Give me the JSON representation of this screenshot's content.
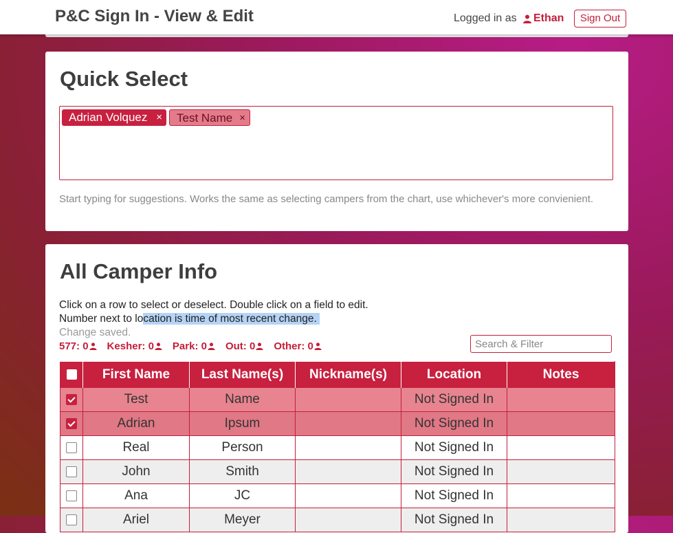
{
  "header": {
    "title": "P&C Sign In - View & Edit",
    "logged_in_label": "Logged in as",
    "user_name": "Ethan",
    "sign_out_label": "Sign Out"
  },
  "quick_select": {
    "title": "Quick Select",
    "chips": [
      {
        "label": "Adrian Volquez",
        "remove": "×"
      },
      {
        "label": "Test Name",
        "remove": "×"
      }
    ],
    "help": "Start typing for suggestions. Works the same as selecting campers from the chart, use whichever's more convienient."
  },
  "all_info": {
    "title": "All Camper Info",
    "line1": "Click on a row to select or deselect. Double click on a field to edit.",
    "line2_a": "Number next to lo",
    "line2_b": "cation is time of most recent change.",
    "saved": "Change saved.",
    "counts": [
      {
        "label": "577: 0"
      },
      {
        "label": "Kesher: 0"
      },
      {
        "label": "Park: 0"
      },
      {
        "label": "Out: 0"
      },
      {
        "label": "Other: 0"
      }
    ],
    "search_placeholder": "Search & Filter",
    "columns": [
      "First Name",
      "Last Name(s)",
      "Nickname(s)",
      "Location",
      "Notes"
    ],
    "rows": [
      {
        "checked": true,
        "first": "Test",
        "last": "Name",
        "nick": "",
        "location": "Not Signed In",
        "notes": ""
      },
      {
        "checked": true,
        "first": "Adrian",
        "last": "Ipsum",
        "nick": "",
        "location": "Not Signed In",
        "notes": ""
      },
      {
        "checked": false,
        "first": "Real",
        "last": "Person",
        "nick": "",
        "location": "Not Signed In",
        "notes": ""
      },
      {
        "checked": false,
        "first": "John",
        "last": "Smith",
        "nick": "",
        "location": "Not Signed In",
        "notes": ""
      },
      {
        "checked": false,
        "first": "Ana",
        "last": "JC",
        "nick": "",
        "location": "Not Signed In",
        "notes": ""
      },
      {
        "checked": false,
        "first": "Ariel",
        "last": "Meyer",
        "nick": "",
        "location": "Not Signed In",
        "notes": ""
      }
    ]
  },
  "colors": {
    "accent": "#c41e3a",
    "selected_row": "#e8848f",
    "alt_row": "#eeeeee"
  }
}
